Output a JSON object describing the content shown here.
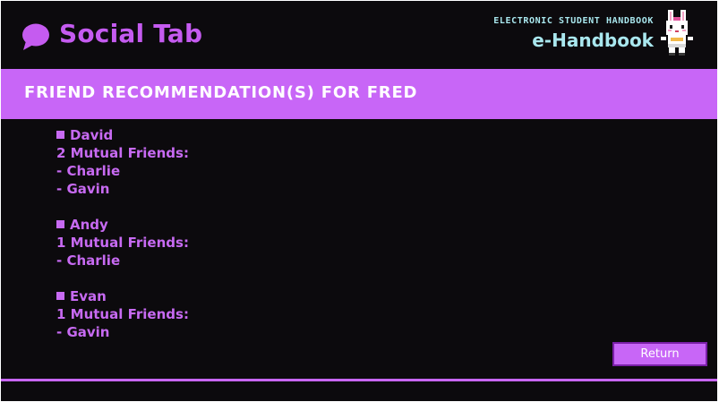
{
  "header": {
    "title": "Social Tab",
    "icon": "chat-bubble-icon",
    "brand_subtitle": "ELECTRONIC STUDENT HANDBOOK",
    "brand_title": "e-Handbook",
    "mascot": "bunny-mascot"
  },
  "banner": {
    "title": "FRIEND RECOMMENDATION(S) FOR FRED"
  },
  "recommendations": [
    {
      "name": "David",
      "mutual_label": "2 Mutual Friends:",
      "mutual_friends": [
        "- Charlie",
        "- Gavin"
      ]
    },
    {
      "name": "Andy",
      "mutual_label": "1 Mutual Friends:",
      "mutual_friends": [
        "- Charlie"
      ]
    },
    {
      "name": "Evan",
      "mutual_label": "1 Mutual Friends:",
      "mutual_friends": [
        "- Gavin"
      ]
    }
  ],
  "actions": {
    "return_label": "Return"
  },
  "colors": {
    "background": "#0c0a0d",
    "accent": "#c866f7",
    "text_accent": "#c76af2",
    "brand": "#a9e7ee"
  }
}
